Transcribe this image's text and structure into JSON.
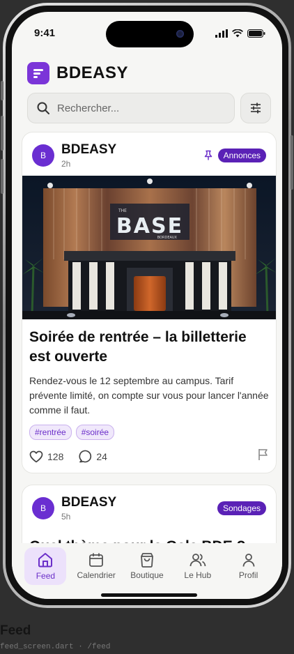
{
  "status_bar": {
    "time": "9:41"
  },
  "app": {
    "title": "BDEASY"
  },
  "search": {
    "placeholder": "Rechercher..."
  },
  "posts": [
    {
      "author": "BDEASY",
      "avatar_letter": "B",
      "time": "2h",
      "badge": "Annonces",
      "pinned": true,
      "image_sign": "BASE",
      "image_sign_sub": "BORDEAUX",
      "image_sign_prefix": "THE",
      "title": "Soirée de rentrée – la billetterie est ouverte",
      "body": "Rendez-vous le 12 septembre au campus. Tarif prévente limité, on compte sur vous pour lancer l'année comme il faut.",
      "tags": [
        "#rentrée",
        "#soirée"
      ],
      "likes": "128",
      "comments": "24"
    },
    {
      "author": "BDEASY",
      "avatar_letter": "B",
      "time": "5h",
      "badge": "Sondages",
      "title": "Quel thème pour le Gala BDE ?"
    }
  ],
  "bottom_nav": [
    {
      "label": "Feed",
      "icon": "home-icon",
      "active": true
    },
    {
      "label": "Calendrier",
      "icon": "calendar-icon"
    },
    {
      "label": "Boutique",
      "icon": "shopping-bag-icon"
    },
    {
      "label": "Le Hub",
      "icon": "users-icon"
    },
    {
      "label": "Profil",
      "icon": "user-icon"
    }
  ],
  "caption": {
    "title": "Feed",
    "subtitle": "feed_screen.dart · /feed"
  },
  "colors": {
    "accent": "#7b35d8",
    "badge": "#5a21b6",
    "background": "#2f2f2f"
  }
}
